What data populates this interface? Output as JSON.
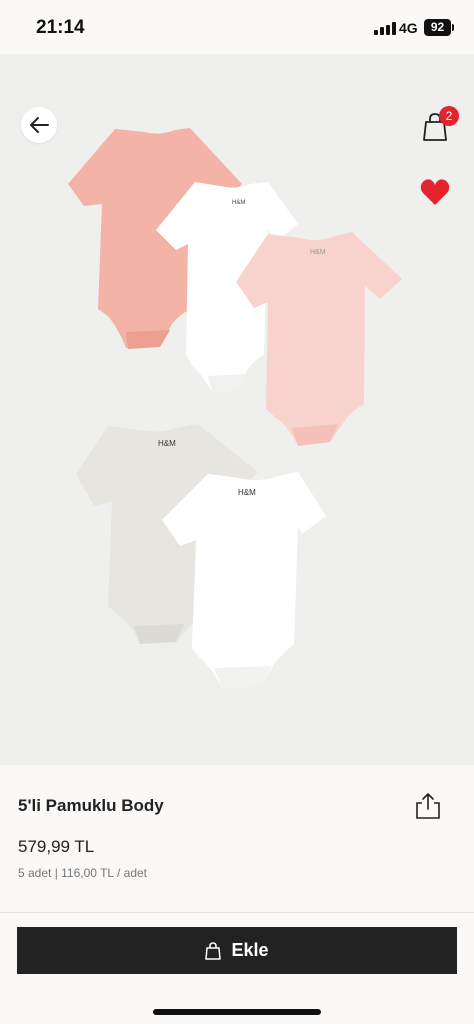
{
  "status_bar": {
    "time": "21:14",
    "network": "4G",
    "battery": "92"
  },
  "header": {
    "cart_count": "2",
    "back_icon": "arrow-left-icon",
    "cart_icon": "shopping-bag-icon",
    "favorite_icon": "heart-icon",
    "favorite_color": "#e3232d"
  },
  "gallery": {
    "image_count": 3,
    "active_index": 0,
    "garment_label": "H&M",
    "colors": {
      "pink": "#f3b3a6",
      "light_pink": "#f8d3cd",
      "white": "#ffffff",
      "grey": "#e6e5e0"
    }
  },
  "product": {
    "title": "5'li Pamuklu Body",
    "price": "579,99 TL",
    "unit_info": "5 adet | 116,00 TL / adet"
  },
  "actions": {
    "add_label": "Ekle"
  }
}
